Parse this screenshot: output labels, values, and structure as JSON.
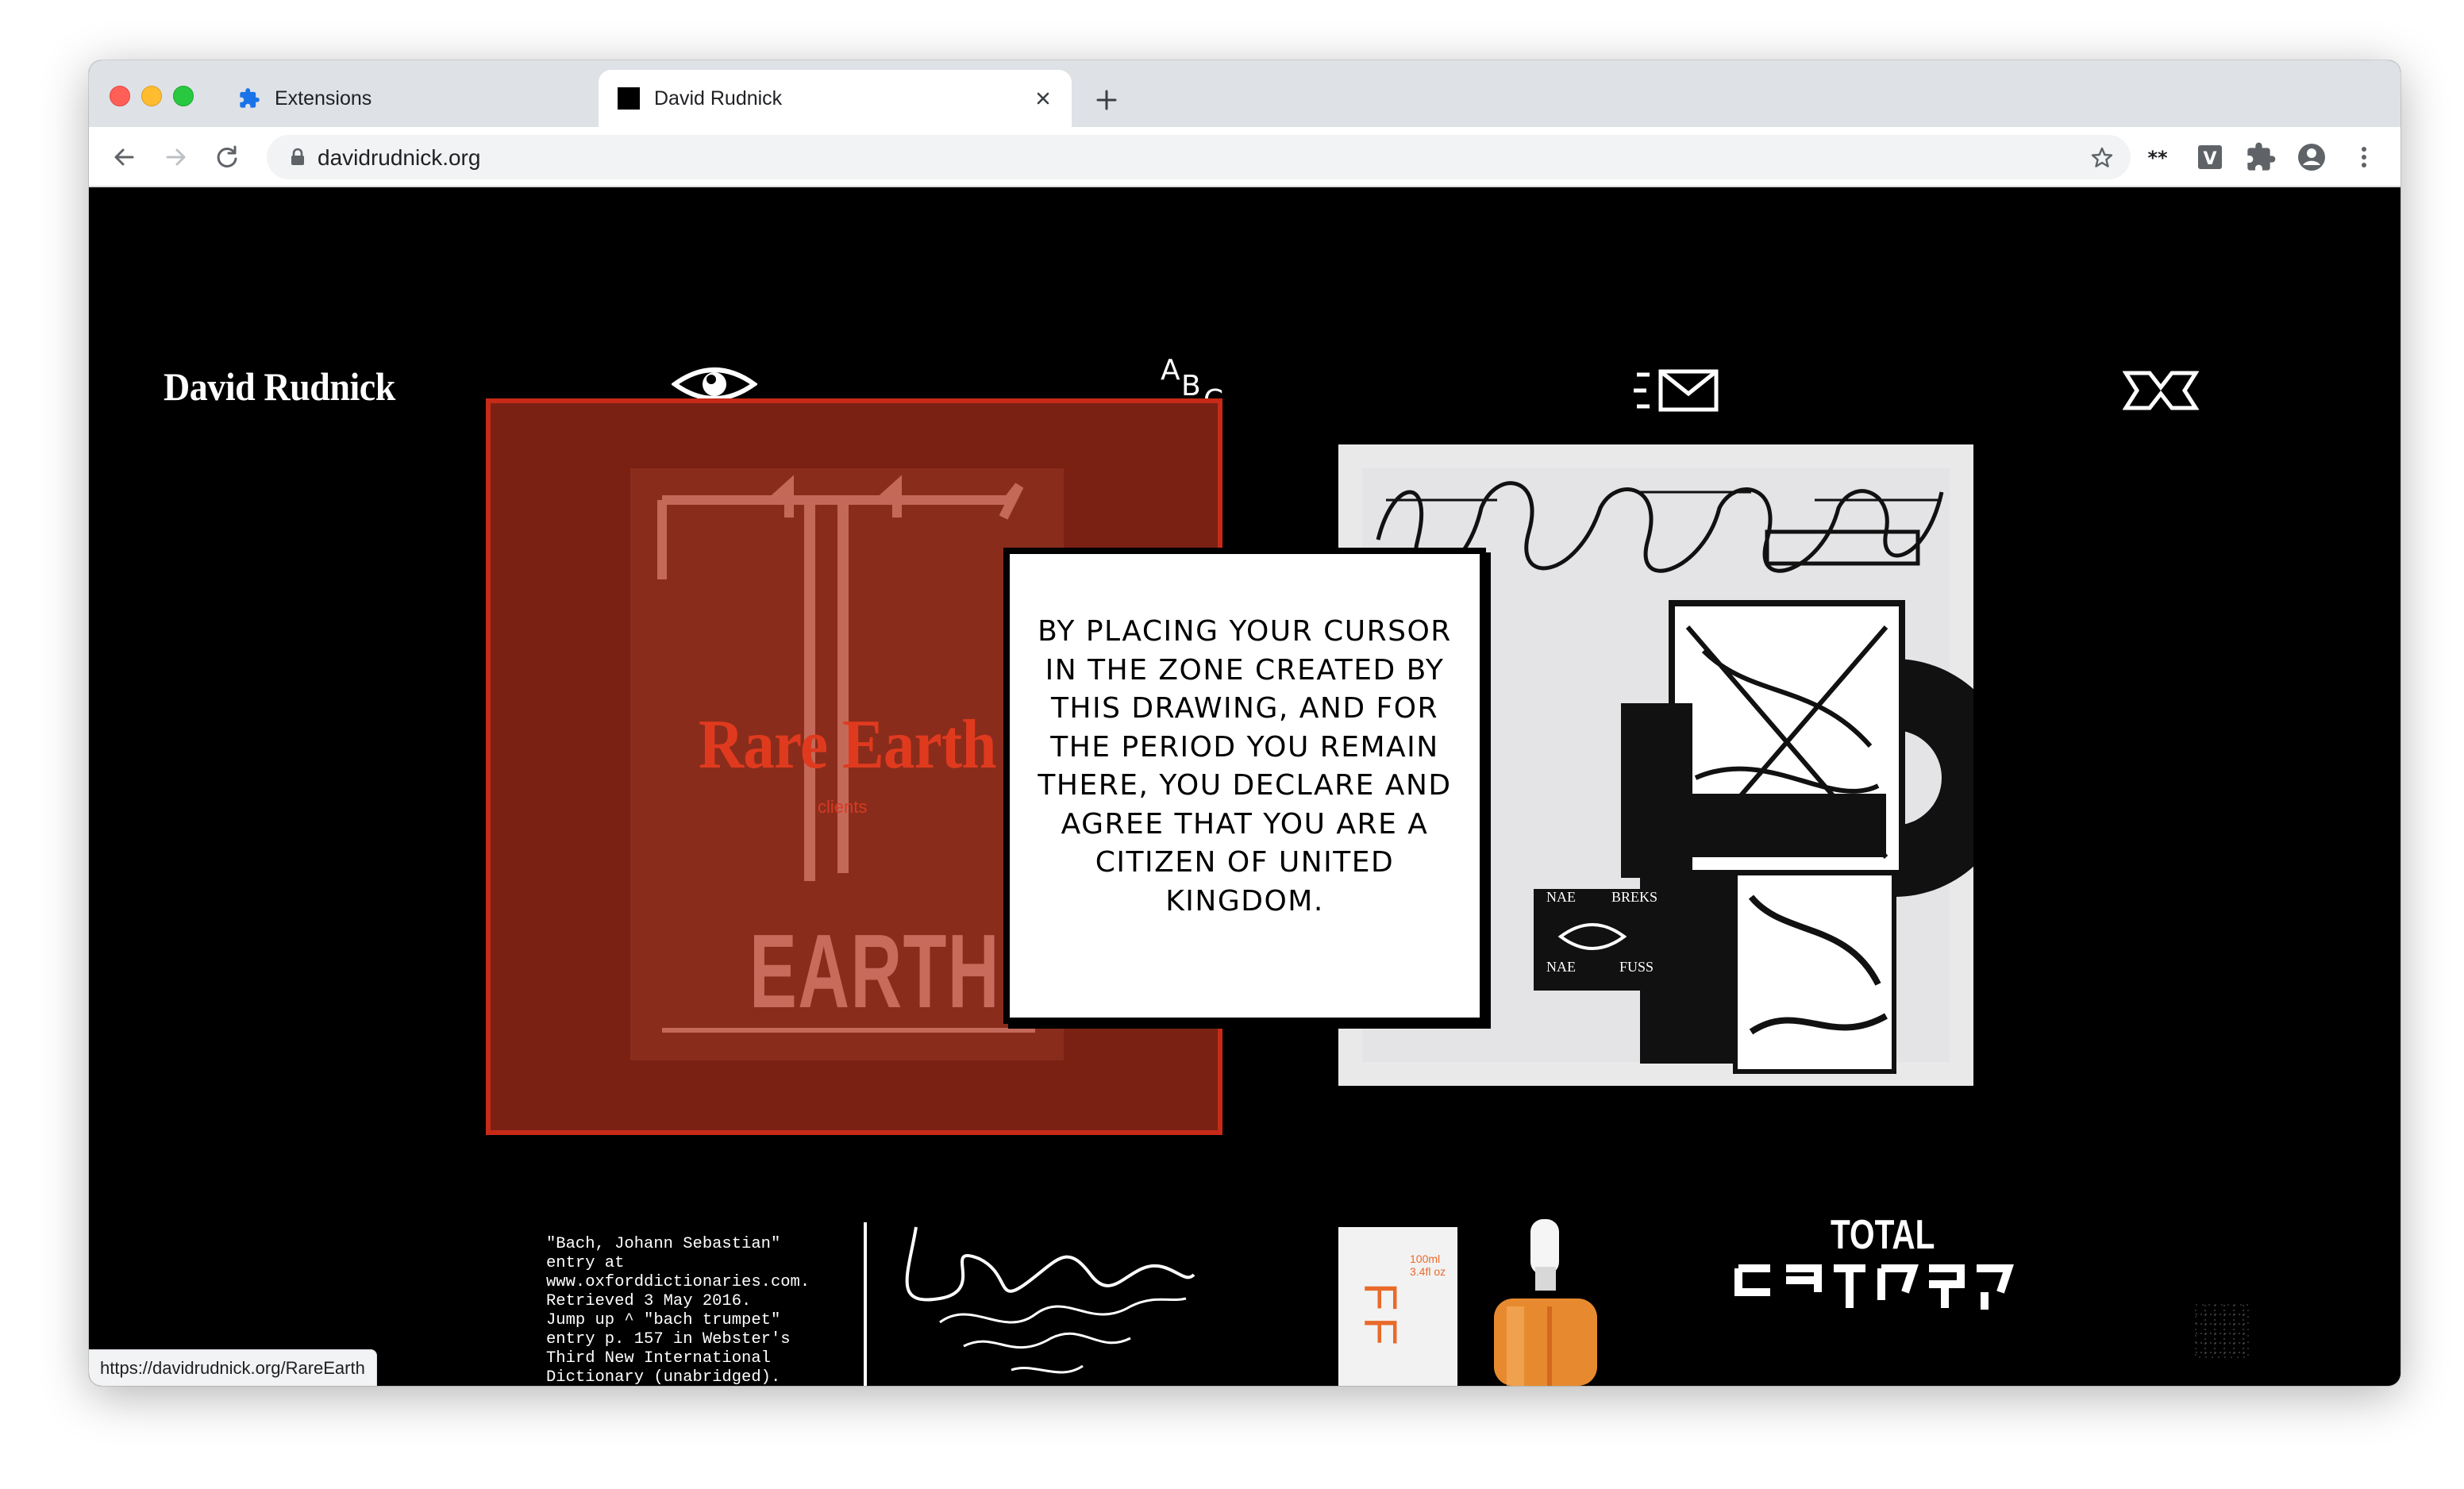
{
  "browser": {
    "tabs": [
      {
        "title": "Extensions",
        "icon": "puzzle-icon",
        "active": false
      },
      {
        "title": "David Rudnick",
        "icon": "black-square-favicon",
        "active": true
      }
    ],
    "url": "davidrudnick.org",
    "status_url": "https://davidrudnick.org/RareEarth"
  },
  "site": {
    "title": "David Rudnick",
    "nav": [
      {
        "name": "eye-icon"
      },
      {
        "name": "abc-icon",
        "letters": [
          "A",
          "B",
          "C"
        ]
      },
      {
        "name": "mail-icon"
      },
      {
        "name": "bowtie-icon"
      }
    ]
  },
  "projects": {
    "rare_earth": {
      "title": "Rare Earth",
      "subtitle": "clients",
      "cover_text": "EARTH",
      "colors": {
        "bg": "#7a2114",
        "border": "#c72a18",
        "title": "#e03a1e"
      }
    },
    "hardcore": {
      "labels": [
        "NAE",
        "BREKS",
        "NAE",
        "FUSS"
      ]
    },
    "bach": {
      "citation": "\"Bach, Johann Sebastian\"\nentry at\nwww.oxforddictionaries.com.\nRetrieved 3 May 2016.\nJump up ^ \"bach trumpet\"\nentry p. 157 in Webster's\nThird New International\nDictionary (unabridged)."
    },
    "product": {
      "label": "FF",
      "volume": "100ml\n3.4fl oz"
    },
    "total": {
      "title": "TOTAL"
    }
  },
  "modal": {
    "text": "BY PLACING YOUR CURSOR IN THE ZONE CREATED BY THIS DRAWING, AND FOR THE PERIOD YOU REMAIN THERE, YOU DECLARE AND AGREE THAT YOU ARE A CITIZEN OF UNITED KINGDOM."
  }
}
